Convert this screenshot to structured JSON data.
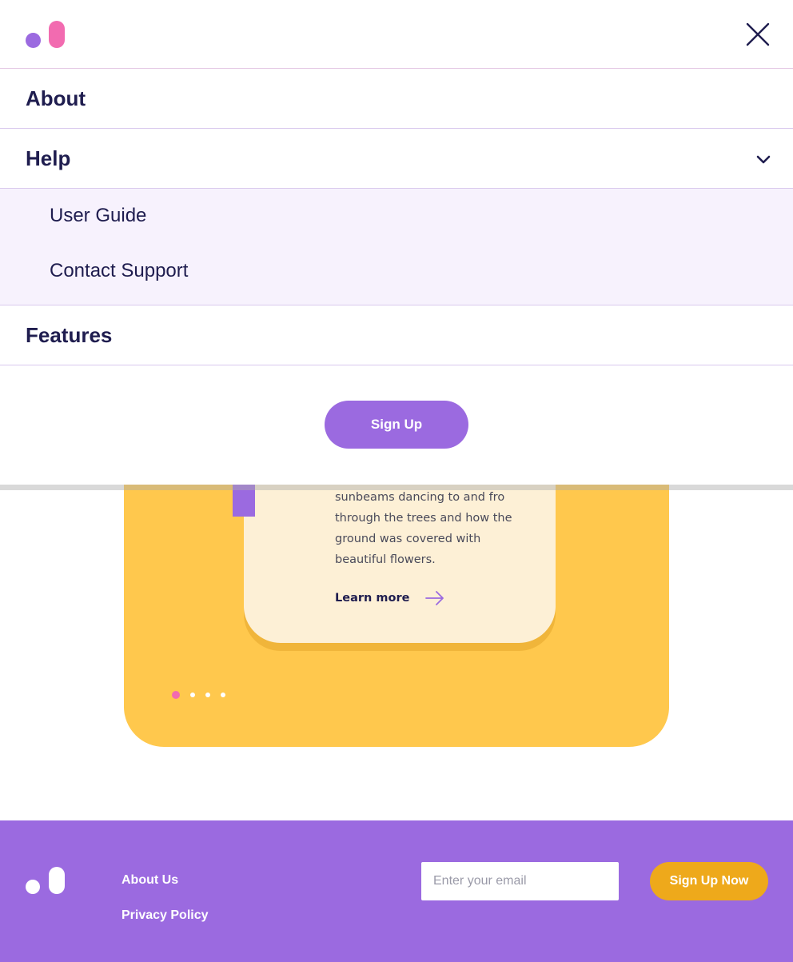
{
  "brand": {
    "colors": {
      "purple": "#9b6ae0",
      "pink": "#f26bb0",
      "yellow": "#ffc84d",
      "navy": "#1f1d4f",
      "orange": "#eea91b"
    }
  },
  "menu": {
    "close_icon": "close-icon",
    "items": [
      {
        "label": "About"
      },
      {
        "label": "Help",
        "expanded": true,
        "icon": "chevron-down-icon",
        "children": [
          {
            "label": "User Guide"
          },
          {
            "label": "Contact Support"
          }
        ]
      },
      {
        "label": "Features"
      }
    ],
    "cta_label": "Sign Up"
  },
  "slide": {
    "text": "sunbeams dancing to and fro through the trees and how the ground was covered with beautiful flowers.",
    "link_label": "Learn more",
    "link_icon": "arrow-right-icon",
    "dots": {
      "count": 4,
      "active_index": 0
    }
  },
  "footer": {
    "links": [
      {
        "label": "About Us"
      },
      {
        "label": "Privacy Policy"
      }
    ],
    "email_placeholder": "Enter your email",
    "email_value": "",
    "button_label": "Sign Up Now"
  }
}
